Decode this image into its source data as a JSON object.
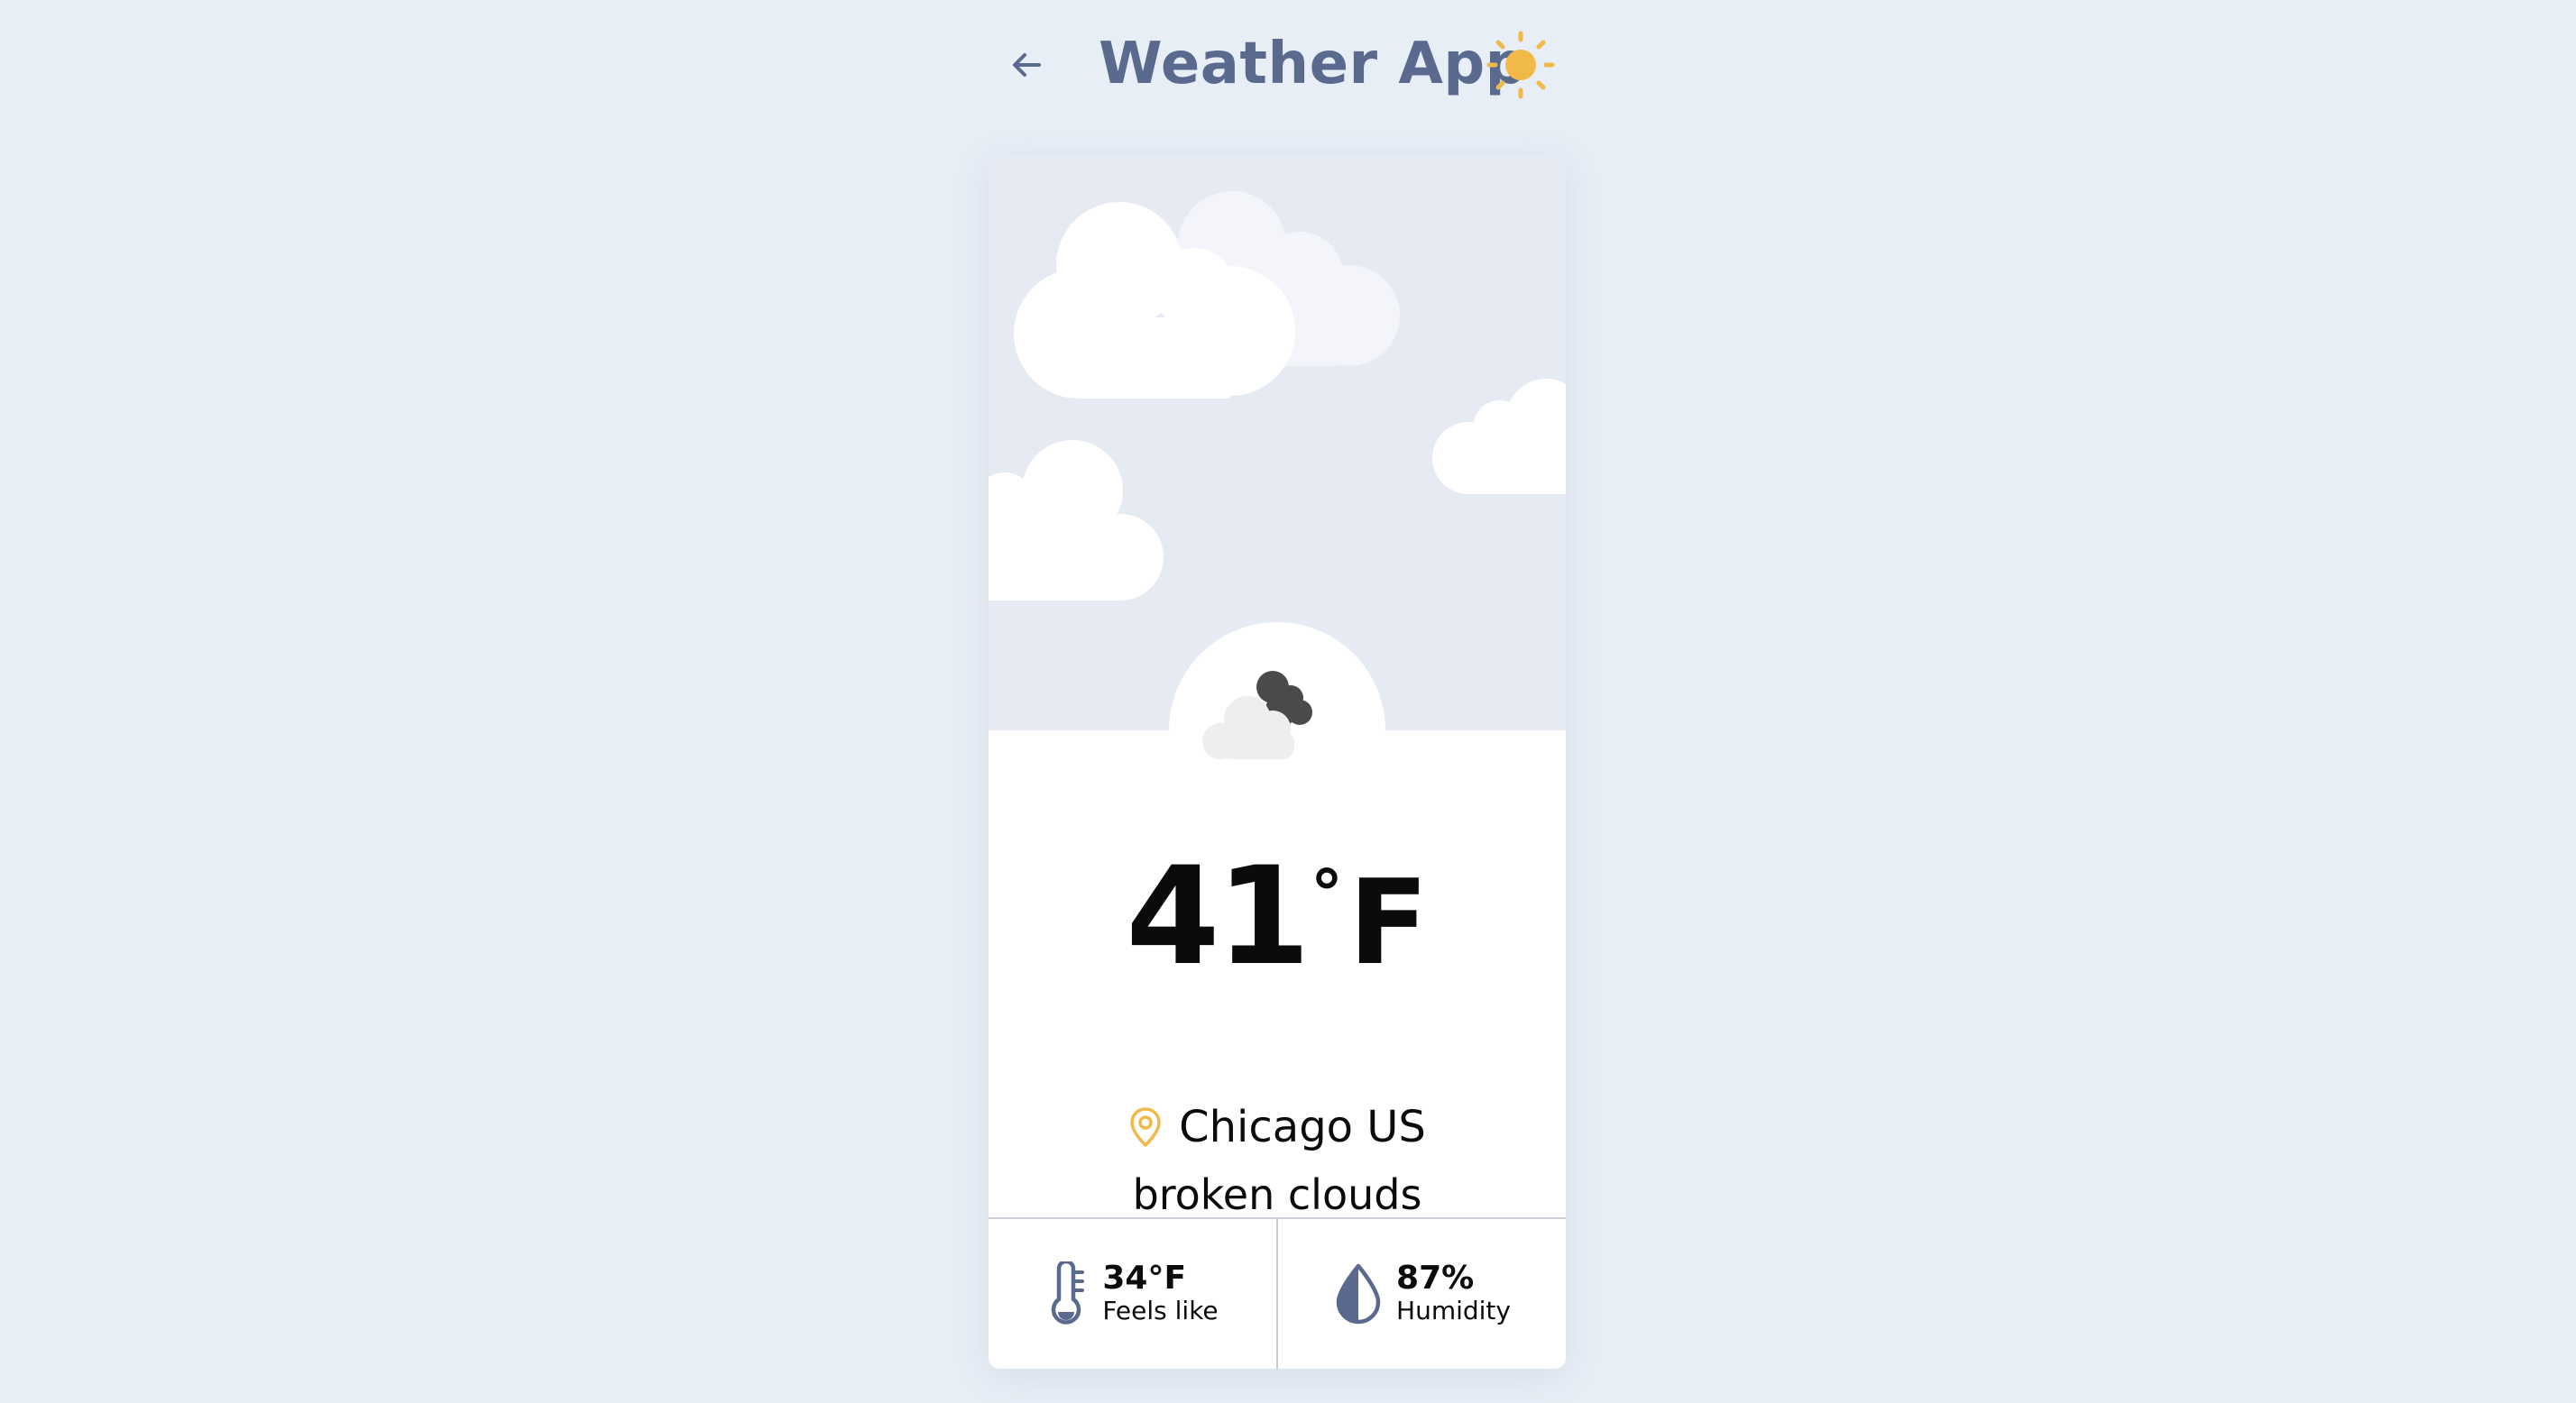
{
  "header": {
    "title": "Weather App",
    "back_icon": "arrow-left-icon",
    "theme_icon": "sun-icon"
  },
  "weather": {
    "temperature": "41",
    "degree_symbol": "°",
    "unit": "F",
    "description": "broken clouds",
    "location": "Chicago US",
    "condition_icon": "broken-clouds-icon",
    "location_icon": "map-pin-icon"
  },
  "stats": {
    "feels_like": {
      "value": "34°F",
      "label": "Feels like",
      "icon": "thermometer-icon"
    },
    "humidity": {
      "value": "87%",
      "label": "Humidity",
      "icon": "droplet-icon"
    }
  },
  "colors": {
    "background": "#e8eef6",
    "title": "#5a6a8e",
    "accent": "#f0b94a",
    "card": "#ffffff",
    "sky": "#e6ebf3"
  }
}
